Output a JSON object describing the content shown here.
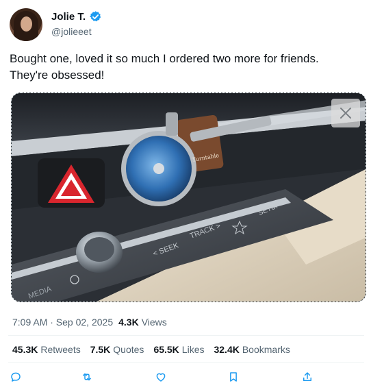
{
  "author": {
    "display_name": "Jolie T.",
    "handle": "@jolieeet",
    "avatar_icon": "profile-photo",
    "verified_icon": "verified-badge-icon",
    "verified_color": "#1d9bf0"
  },
  "tweet": {
    "text": "Bought one, loved it so much I ordered two more for friends. They're obsessed!"
  },
  "media": {
    "close_icon": "close-icon",
    "scene_labels": {
      "seek": "< SEEK",
      "track": "TRACK >",
      "setup": "SETUP",
      "media": "MEDIA",
      "brand": "Turntable"
    }
  },
  "meta": {
    "timestamp": "7:09 AM · Sep 02, 2025",
    "views_count": "4.3K",
    "views_label": "Views"
  },
  "stats": {
    "retweets_count": "45.3K",
    "retweets_label": "Retweets",
    "quotes_count": "7.5K",
    "quotes_label": "Quotes",
    "likes_count": "65.5K",
    "likes_label": "Likes",
    "bookmarks_count": "32.4K",
    "bookmarks_label": "Bookmarks"
  },
  "actions": {
    "icons": [
      "reply-icon",
      "retweet-icon",
      "like-icon",
      "bookmark-icon",
      "share-icon"
    ],
    "accent_color": "#1d9bf0"
  }
}
